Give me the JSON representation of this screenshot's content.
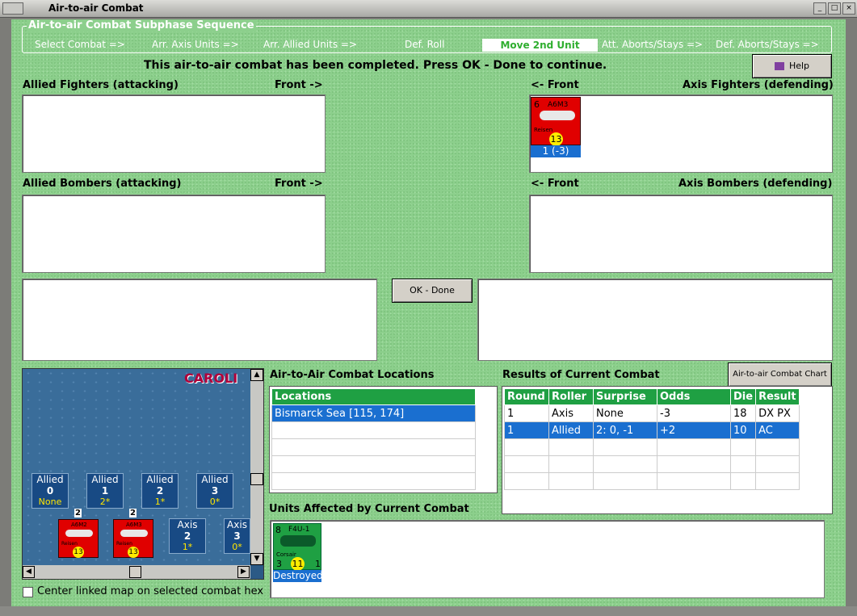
{
  "window": {
    "title": "Air-to-air Combat"
  },
  "sequence": {
    "title": "Air-to-air Combat Subphase Sequence",
    "steps": [
      "Select Combat =>",
      "Arr. Axis Units =>",
      "Arr. Allied Units =>",
      "Def. Roll",
      "Move 2nd Unit",
      "Att. Aborts/Stays =>",
      "Def. Aborts/Stays =>"
    ],
    "active_step": "Move 2nd Unit"
  },
  "message": "This air-to-air combat has been completed.  Press OK - Done to continue.",
  "help_label": "Help",
  "ok_label": "OK - Done",
  "chart_button_label": "Air-to-air Combat Chart",
  "panels": {
    "allied_fighters": "Allied Fighters (attacking)",
    "allied_bombers": "Allied Bombers (attacking)",
    "axis_fighters": "Axis Fighters (defending)",
    "axis_bombers": "Axis Bombers (defending)",
    "front_right": "Front ->",
    "front_left": "<- Front"
  },
  "axis_fighter_unit": {
    "type": "A6M3",
    "strength": "6",
    "name": "Reisen",
    "cost": "13",
    "status": "1 (-3)"
  },
  "map": {
    "label": "CAROLI",
    "allied_stats": [
      {
        "title": "Allied",
        "num": "0",
        "val": "None"
      },
      {
        "title": "Allied",
        "num": "1",
        "val": "2*"
      },
      {
        "title": "Allied",
        "num": "2",
        "val": "1*"
      },
      {
        "title": "Allied",
        "num": "3",
        "val": "0*"
      }
    ],
    "axis_stats": [
      {
        "title": "Axis",
        "num": "2",
        "val": "1*"
      },
      {
        "title": "Axis",
        "num": "3",
        "val": "0*"
      }
    ],
    "counters": [
      {
        "stack": "2",
        "type": "A6M2",
        "name": "Reisen",
        "cost": "13"
      },
      {
        "stack": "2",
        "type": "A6M3",
        "name": "Reisen",
        "cost": "13"
      }
    ],
    "center_label": "Center linked map on selected combat hex"
  },
  "locations": {
    "title": "Air-to-Air Combat Locations",
    "header": "Locations",
    "rows": [
      "Bismarck Sea [115, 174]",
      "",
      "",
      "",
      ""
    ]
  },
  "results": {
    "title": "Results of Current Combat",
    "headers": [
      "Round",
      "Roller",
      "Surprise",
      "Odds",
      "Die",
      "Result"
    ],
    "rows": [
      [
        "1",
        "Axis",
        "None",
        "-3",
        "18",
        "DX PX"
      ],
      [
        "1",
        "Allied",
        "2: 0, -1",
        "+2",
        "10",
        "AC"
      ],
      [
        "",
        "",
        "",
        "",
        "",
        ""
      ],
      [
        "",
        "",
        "",
        "",
        "",
        ""
      ],
      [
        "",
        "",
        "",
        "",
        "",
        ""
      ]
    ]
  },
  "affected": {
    "title": "Units Affected by Current Combat",
    "unit": {
      "type": "F4U-1",
      "strength": "8",
      "name": "Corsair",
      "left": "3",
      "cost": "11",
      "right": "1",
      "status": "Destroyed"
    }
  }
}
